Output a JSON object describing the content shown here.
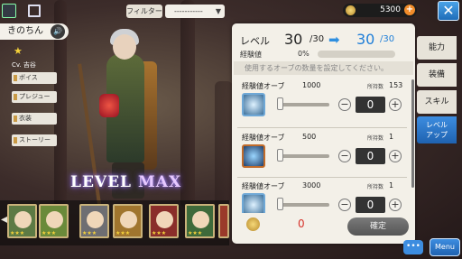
{
  "top_bar": {
    "filter_label": "フィルター",
    "filter_value": "-----------",
    "coins": "5300",
    "coin_plus": "+",
    "close_glyph": "✕"
  },
  "character": {
    "name": "きのちん",
    "voice_glyph": "🔊",
    "star": "★",
    "cv": "Cv. 吉谷",
    "level_max_a": "LEVEL ",
    "level_max_b": "MAX"
  },
  "side_buttons": [
    "ボイス",
    "プレジュー",
    "衣装",
    "ストーリー"
  ],
  "party": {
    "arrow": "◀",
    "members": [
      {
        "stars": "★★★"
      },
      {
        "stars": "★★★"
      },
      {
        "stars": "★★★"
      },
      {
        "stars": "★★★"
      },
      {
        "stars": "★★★"
      },
      {
        "stars": "★★★"
      },
      {
        "stars": "★★★"
      }
    ]
  },
  "level_panel": {
    "level_label": "レベル",
    "level_before": "30",
    "level_before_max": "/30",
    "arrow": "➡",
    "level_after": "30",
    "level_after_max": "/30",
    "exp_label": "経験値",
    "exp_percent": "0%",
    "exp_fill_fraction": 0,
    "hint": "使用するオーブの数量を設定してください。",
    "held_label": "所持数",
    "orbs": [
      {
        "name": "経験値オーブ",
        "exp": "1000",
        "held": "153",
        "qty": "0",
        "minus": "−",
        "plus": "+"
      },
      {
        "name": "経験値オーブ",
        "exp": "500",
        "held": "1",
        "qty": "0",
        "minus": "−",
        "plus": "+"
      },
      {
        "name": "経験値オーブ",
        "exp": "3000",
        "held": "1",
        "qty": "0",
        "minus": "−",
        "plus": "+"
      }
    ],
    "cost": "0",
    "confirm_label": "確定"
  },
  "tabs": {
    "ability": "能力",
    "equip": "装備",
    "skill": "スキル",
    "levelup_line1": "レベル",
    "levelup_line2": "アップ"
  },
  "footer": {
    "chat_glyph": "•••",
    "menu_label": "Menu"
  }
}
